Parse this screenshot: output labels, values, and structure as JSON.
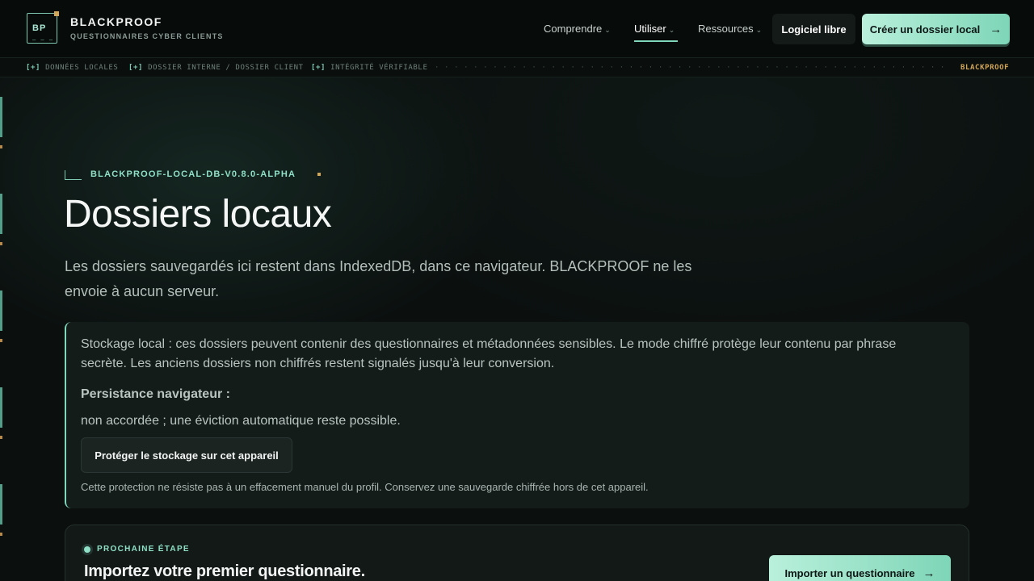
{
  "brand": {
    "logo_text": "BP",
    "logo_marks": "— — —",
    "name": "BLACKPROOF",
    "tagline": "QUESTIONNAIRES CYBER CLIENTS"
  },
  "nav": {
    "items": [
      {
        "label": "Comprendre"
      },
      {
        "label": "Utiliser"
      },
      {
        "label": "Ressources"
      }
    ],
    "active": "Utiliser",
    "free_software": "Logiciel libre",
    "cta": "Créer un dossier local",
    "chevron": "⌄",
    "arrow": "→"
  },
  "strip": {
    "marker": "[+]",
    "tags": [
      "DONNÉES LOCALES",
      "DOSSIER INTERNE / DOSSIER CLIENT",
      "INTÉGRITÉ VÉRIFIABLE"
    ],
    "brand": "BLACKPROOF"
  },
  "hero": {
    "version": "BLACKPROOF-LOCAL-DB-V0.8.0-ALPHA",
    "title": "Dossiers locaux",
    "lead": "Les dossiers sauvegardés ici restent dans IndexedDB, dans ce navigateur. BLACKPROOF ne les envoie à aucun serveur."
  },
  "storage_card": {
    "warning": "Stockage local : ces dossiers peuvent contenir des questionnaires et métadonnées sensibles. Le mode chiffré protège leur contenu par phrase secrète. Les anciens dossiers non chiffrés restent signalés jusqu'à leur conversion.",
    "persistence_label": "Persistance navigateur :",
    "persistence_value": "non accordée ; une éviction automatique reste possible.",
    "protect_button": "Protéger le stockage sur cet appareil",
    "note": "Cette protection ne résiste pas à un effacement manuel du profil. Conservez une sauvegarde chiffrée hors de cet appareil."
  },
  "next_step": {
    "eyebrow": "PROCHAINE ÉTAPE",
    "heading": "Importez votre premier questionnaire.",
    "button": "Importer un questionnaire"
  },
  "colors": {
    "accent": "#7fd6bb",
    "gold": "#d2a658",
    "background": "#0b100f"
  }
}
